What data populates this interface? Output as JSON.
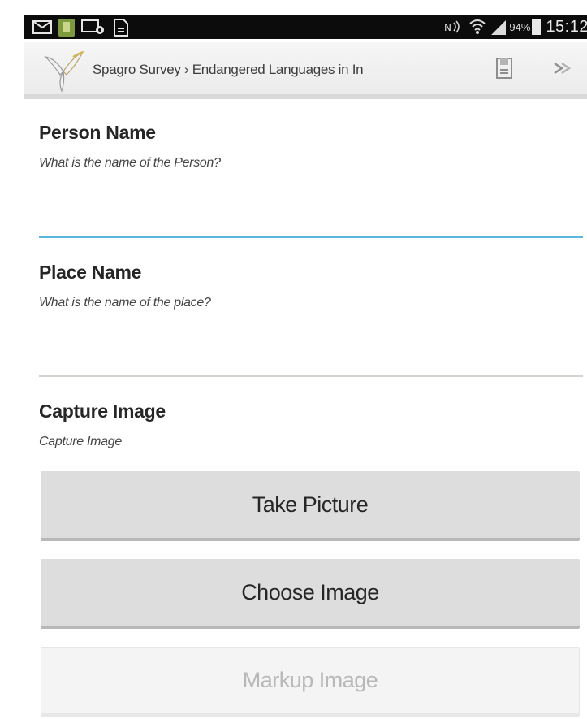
{
  "status_bar": {
    "battery_percent": "94%",
    "time": "15:12"
  },
  "action_bar": {
    "breadcrumb": "Spagro Survey › Endangered Languages in In"
  },
  "questions": [
    {
      "label": "Person Name",
      "hint": "What is the name of the Person?",
      "value": ""
    },
    {
      "label": "Place Name",
      "hint": "What is the name of the place?",
      "value": ""
    },
    {
      "label": "Capture Image",
      "hint": "Capture Image"
    }
  ],
  "buttons": {
    "take_picture": "Take Picture",
    "choose_image": "Choose Image",
    "markup_image": "Markup Image"
  },
  "colors": {
    "input_focus": "#5bb6dc",
    "input_idle": "#d6d2cd",
    "button_bg": "#dddddd",
    "button_disabled_text": "#b8b8b8"
  }
}
